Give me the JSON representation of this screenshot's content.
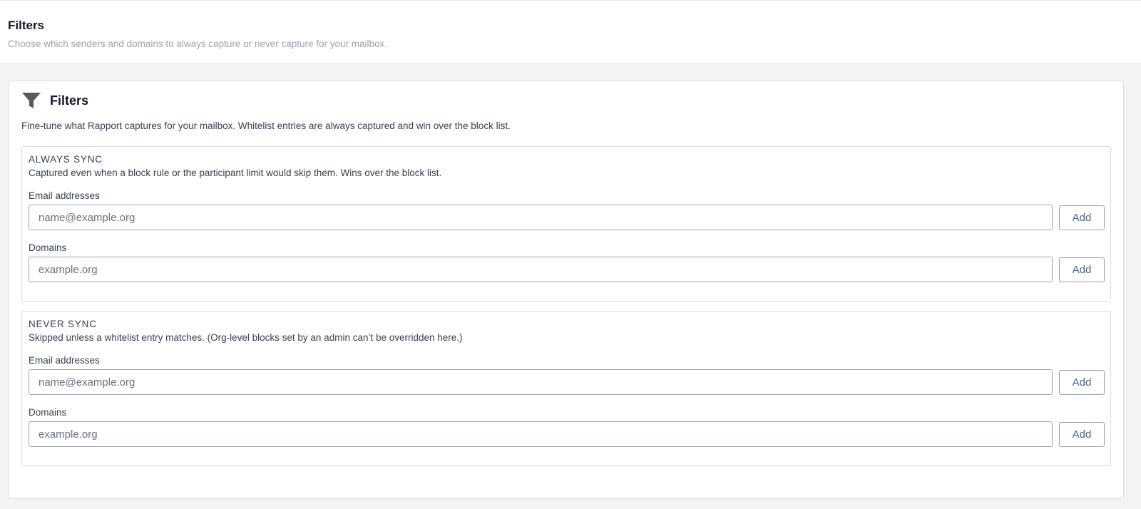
{
  "header": {
    "title": "Filters",
    "subtitle": "Choose which senders and domains to always capture or never capture for your mailbox."
  },
  "card": {
    "icon": "filter-icon",
    "title": "Filters",
    "description": "Fine-tune what Rapport captures for your mailbox. Whitelist entries are always captured and win over the block list."
  },
  "always_sync": {
    "title": "ALWAYS SYNC",
    "description": "Captured even when a block rule or the participant limit would skip them. Wins over the block list.",
    "email_label": "Email addresses",
    "email_placeholder": "name@example.org",
    "email_value": "",
    "domain_label": "Domains",
    "domain_placeholder": "example.org",
    "domain_value": "",
    "add_label": "Add"
  },
  "never_sync": {
    "title": "NEVER SYNC",
    "description": "Skipped unless a whitelist entry matches. (Org-level blocks set by an admin can’t be overridden here.)",
    "email_label": "Email addresses",
    "email_placeholder": "name@example.org",
    "email_value": "",
    "domain_label": "Domains",
    "domain_placeholder": "example.org",
    "domain_value": "",
    "add_label": "Add"
  },
  "colors": {
    "icon": "#555a61",
    "button_text": "#4b6584",
    "subtitle": "#9ca3af"
  }
}
